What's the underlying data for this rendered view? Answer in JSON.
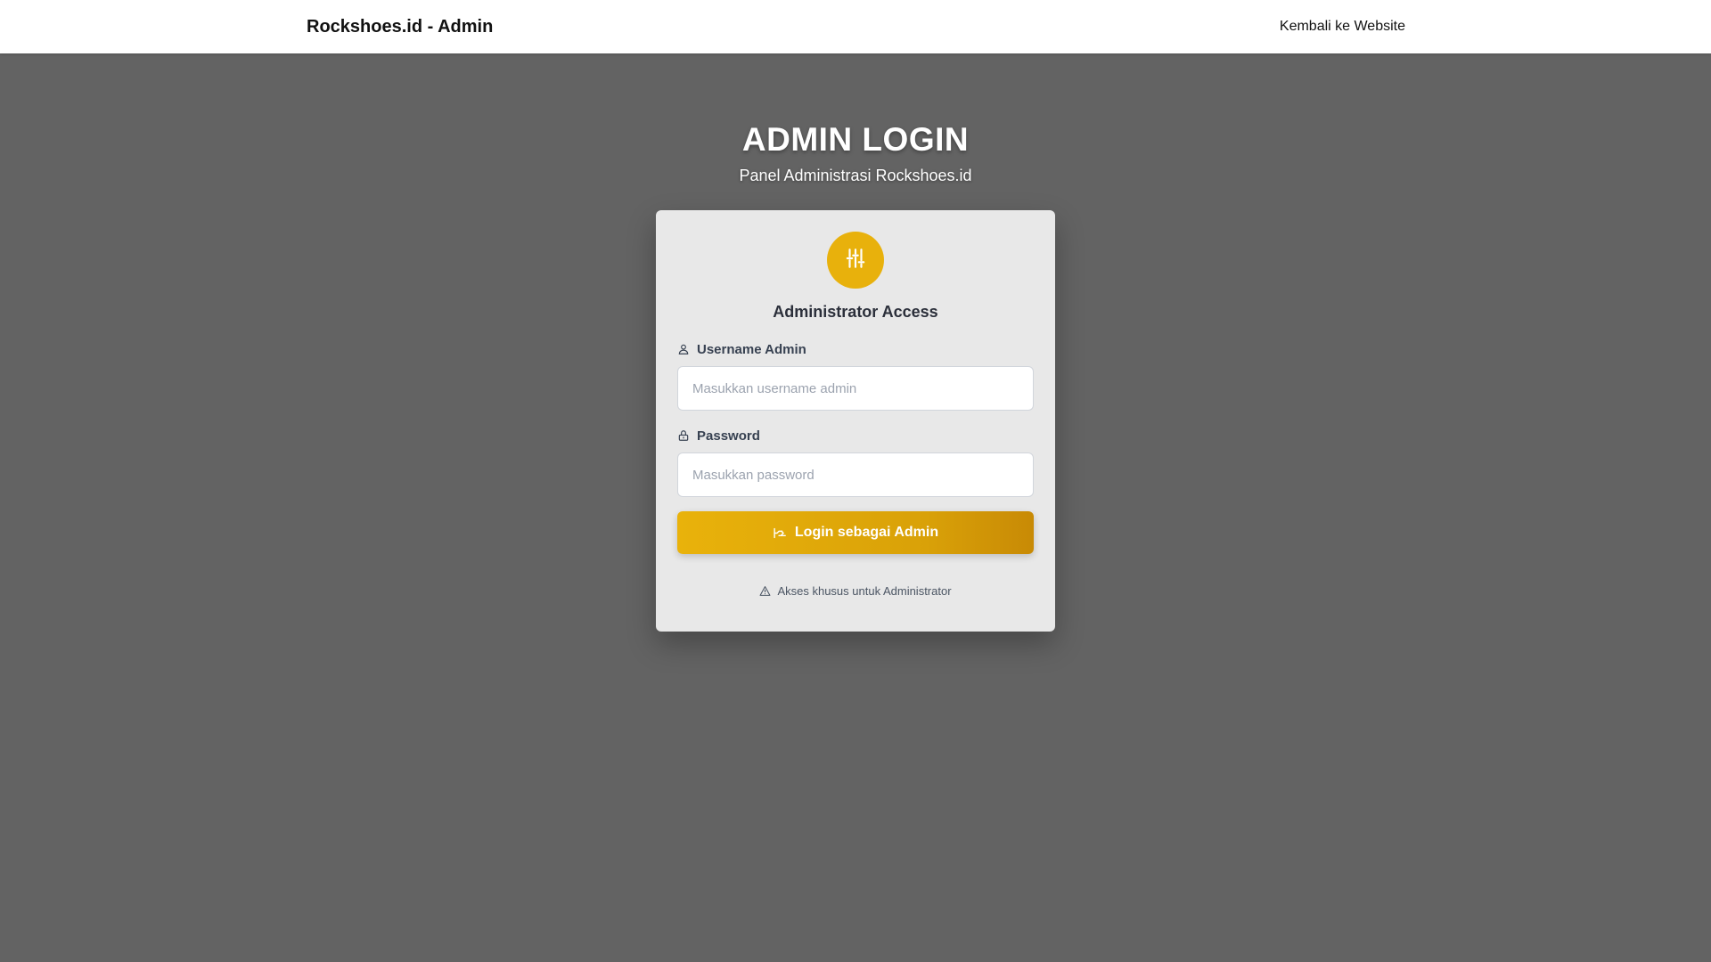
{
  "header": {
    "brand": "Rockshoes.id - Admin",
    "back_link": "Kembali ke Website"
  },
  "hero": {
    "title": "ADMIN LOGIN",
    "subtitle": "Panel Administrasi Rockshoes.id"
  },
  "card": {
    "badge_icon": "sliders-icon",
    "title": "Administrator Access",
    "username": {
      "icon": "user-icon",
      "label": "Username Admin",
      "placeholder": "Masukkan username admin",
      "value": ""
    },
    "password": {
      "icon": "lock-icon",
      "label": "Password",
      "placeholder": "Masukkan password",
      "value": ""
    },
    "submit": {
      "icon": "sign-in-icon",
      "label": "Login sebagai Admin"
    },
    "note": {
      "icon": "warning-triangle-icon",
      "text": "Akses khusus untuk Administrator"
    }
  },
  "colors": {
    "page_background": "#636363",
    "accent": "#e8b10c",
    "card_background": "#e8e8e8"
  }
}
